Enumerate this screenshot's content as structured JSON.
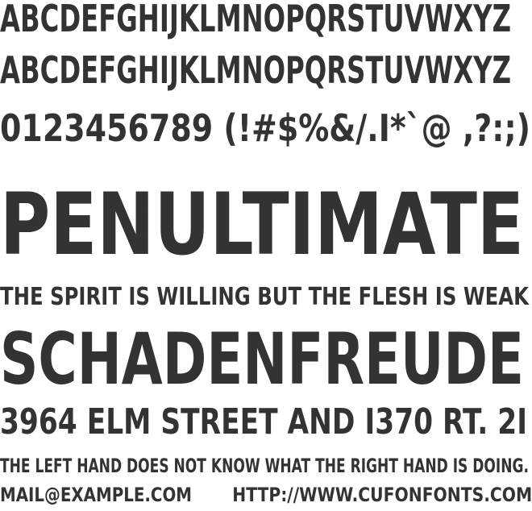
{
  "specimen": {
    "uppercase_line_1": "ABCDEFGHIJKLMNOPQRSTUVWXYZ",
    "uppercase_line_2": "ABCDEFGHIJKLMNOPQRSTUVWXYZ",
    "numerals_symbols": "0123456789 (!#$%&/.I*`@  ,?:;)",
    "word_large": "PENULTIMATE",
    "sentence_1": "THE SPIRIT IS WILLING BUT THE FLESH IS WEAK",
    "word_medium": "SCHADENFREUDE",
    "address": "3964 ELM STREET AND I370 RT. 2I",
    "sentence_2": "THE LEFT HAND DOES NOT KNOW WHAT THE RIGHT HAND IS DOING.",
    "email": "MAIL@EXAMPLE.COM",
    "url": "HTTP://WWW.CUFONFONTS.COM"
  },
  "colors": {
    "text": "#333333",
    "background": "#ffffff"
  }
}
